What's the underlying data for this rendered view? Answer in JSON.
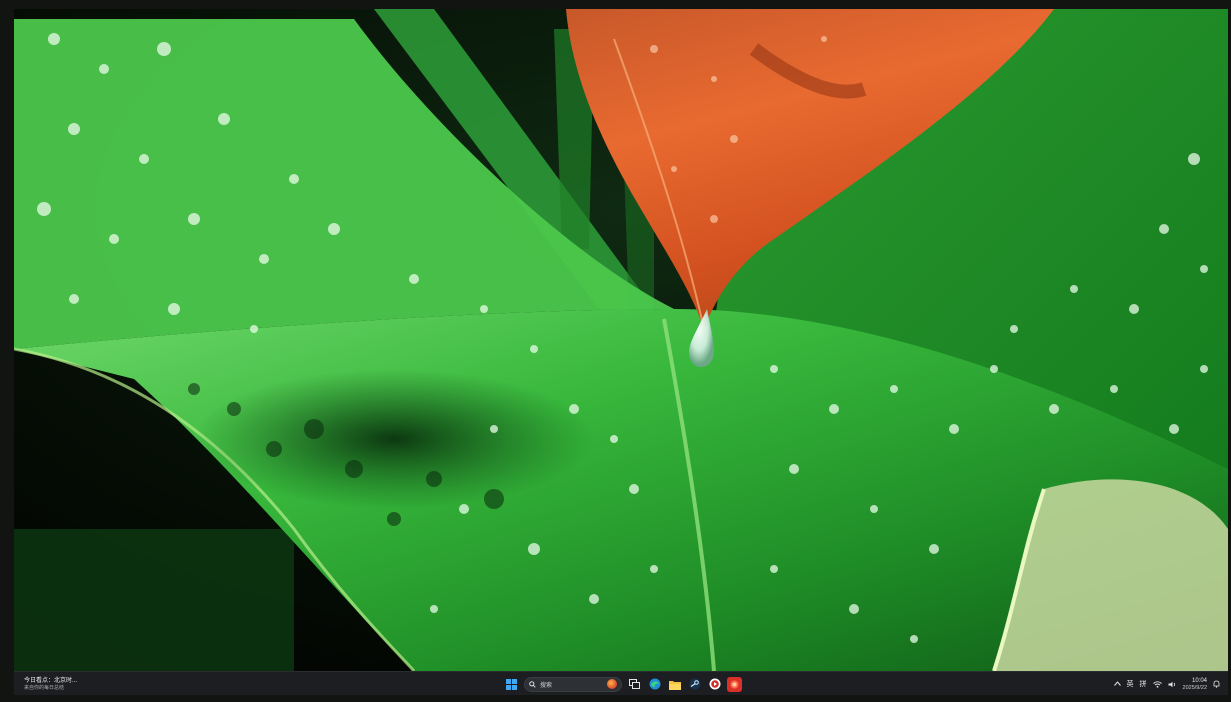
{
  "wallpaper": {
    "subject": "water-droplets-on-green-leaf",
    "colors": {
      "leaf": "#2fae3c",
      "leaf_dark": "#0d4a14",
      "autumn_leaf": "#e0622a",
      "background": "#050805"
    }
  },
  "taskbar": {
    "news": {
      "title": "今日看点：北京时...",
      "subtitle": "来自你的每日总结"
    },
    "search": {
      "placeholder": "搜索"
    },
    "pinned": [
      {
        "icon": "windows-start-icon"
      },
      {
        "icon": "task-view-icon"
      },
      {
        "icon": "edge-browser-icon"
      },
      {
        "icon": "file-explorer-icon"
      },
      {
        "icon": "steam-icon"
      },
      {
        "icon": "media-player-icon"
      },
      {
        "icon": "red-app-icon"
      }
    ],
    "tray": {
      "language": "英",
      "ime": "拼",
      "time": "10:04",
      "date": "2025/9/22"
    }
  }
}
